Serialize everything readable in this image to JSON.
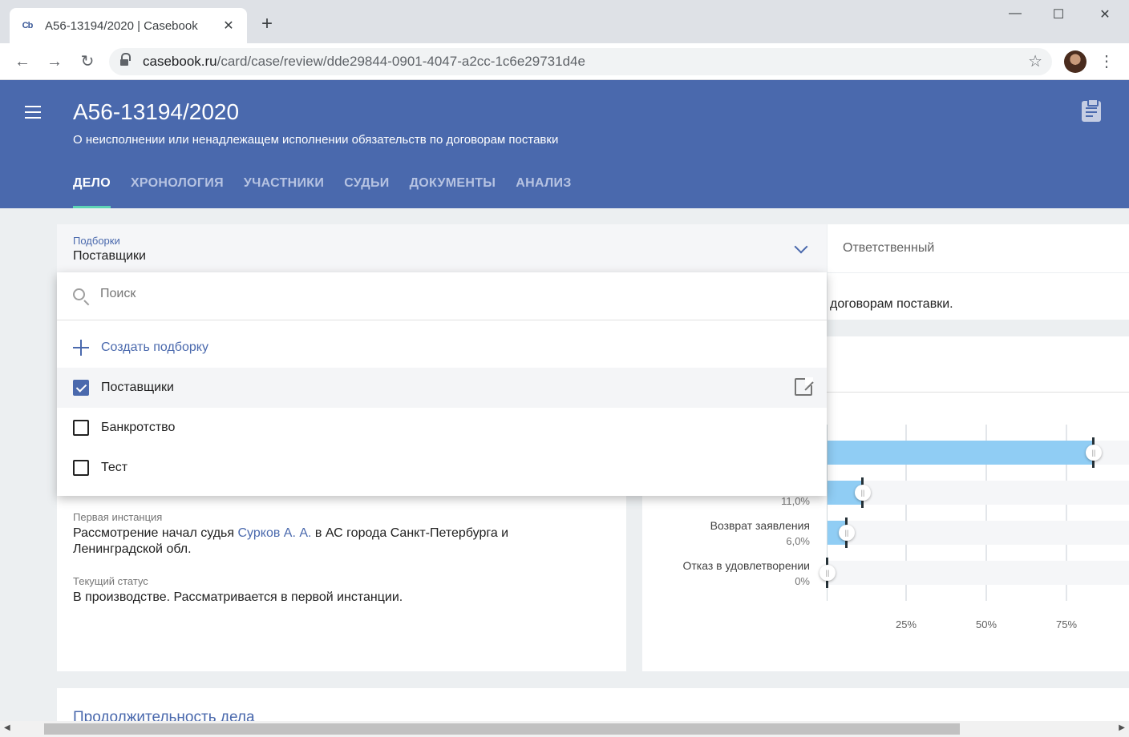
{
  "browser": {
    "tab_title": "А56-13194/2020 | Casebook",
    "favicon_text": "Cb",
    "url_host": "casebook.ru",
    "url_path": "/card/case/review/dde29844-0901-4047-a2cc-1c6e29731d4e"
  },
  "header": {
    "case_number": "А56-13194/2020",
    "case_subject": "О неисполнении или ненадлежащем исполнении обязательств по договорам поставки",
    "tabs": [
      {
        "label": "ДЕЛО",
        "active": true
      },
      {
        "label": "ХРОНОЛОГИЯ"
      },
      {
        "label": "УЧАСТНИКИ"
      },
      {
        "label": "СУДЬИ"
      },
      {
        "label": "ДОКУМЕНТЫ"
      },
      {
        "label": "АНАЛИЗ"
      }
    ]
  },
  "collections_select": {
    "label": "Подборки",
    "value": "Поставщики"
  },
  "responsible": {
    "label": "Ответственный"
  },
  "right_card": {
    "text_fragment": "договорам поставки."
  },
  "dropdown": {
    "search_placeholder": "Поиск",
    "create_label": "Создать подборку",
    "items": [
      {
        "label": "Поставщики",
        "checked": true
      },
      {
        "label": "Банкротство",
        "checked": false
      },
      {
        "label": "Тест",
        "checked": false
      }
    ]
  },
  "case_info": {
    "first_instance_label": "Первая инстанция",
    "first_instance_prefix": "Рассмотрение начал судья ",
    "judge_name": "Сурков А. А.",
    "first_instance_suffix": " в АС города Санкт-Петербурга и Ленинградской обл.",
    "status_label": "Текущий статус",
    "status_text": "В производстве. Рассматривается в первой инстанции."
  },
  "chart_data": {
    "type": "bar",
    "orientation": "horizontal",
    "categories": [
      "",
      "",
      "Возврат заявления",
      "Отказ в удовлетворении"
    ],
    "values": [
      83,
      11.0,
      6.0,
      0
    ],
    "value_labels": [
      "",
      "11,0%",
      "6,0%",
      "0%"
    ],
    "x_ticks": [
      "25%",
      "50%",
      "75%"
    ],
    "xlim": [
      0,
      100
    ],
    "bar_color": "#90cdf4",
    "grid": true
  },
  "section2": {
    "title": "Продолжительность дела"
  }
}
